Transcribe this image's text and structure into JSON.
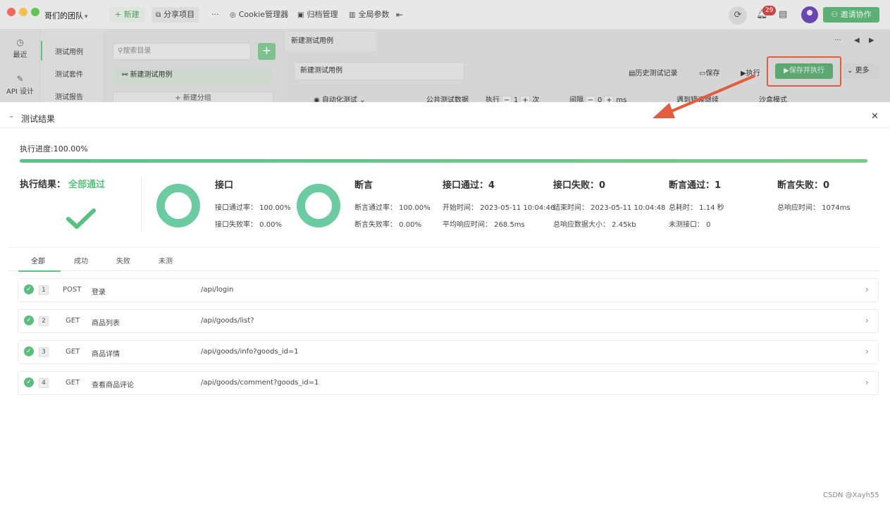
{
  "titlebar": {
    "team_name": "哥们的团队",
    "new_label": "+ 新建",
    "share_label": "分享项目",
    "dots_label": "···",
    "cookie_label": "Cookie管理器",
    "archive_label": "归档管理",
    "params_label": "全局参数",
    "notification_count": "29",
    "invite_label": "邀请协作"
  },
  "leftnav": {
    "items": [
      {
        "label": "最近",
        "icon": "clock-icon"
      },
      {
        "label": "API 设计",
        "icon": "edit-icon"
      }
    ]
  },
  "subnav": {
    "items": [
      "测试用例",
      "测试套件",
      "测试报告"
    ]
  },
  "tree": {
    "search_placeholder": "搜索目录",
    "node_label": "新建测试用例",
    "new_group_label": "+ 新建分组"
  },
  "editor": {
    "tab_label": "新建测试用例",
    "case_name": "新建测试用例",
    "history_label": "历史测试记录",
    "save_label": "保存",
    "run_label": "执行",
    "save_run_label": "保存并执行",
    "more_label": "更多",
    "options": {
      "mode_label": "自动化测试",
      "public_data_label": "公共测试数据",
      "execute_label": "执行",
      "execute_count": "1",
      "times_label": "次",
      "interval_label": "间隔",
      "interval_value": "0",
      "ms_label": "ms",
      "continue_label": "遇到错误继续",
      "sandbox_label": "沙盒模式"
    }
  },
  "result": {
    "title": "测试结果",
    "progress_label": "执行进度:100.00%",
    "progress": 1.0,
    "result_label": "执行结果：",
    "result_value": "全部通过",
    "api_title": "接口",
    "api_pass_rate": "接口通过率：  100.00%",
    "api_fail_rate": "接口失败率：  0.00%",
    "assert_title": "断言",
    "assert_pass_rate": "断言通过率：  100.00%",
    "assert_fail_rate": "断言失败率：  0.00%",
    "api_passed": "接口通过：4",
    "start_time": "开始时间：  2023-05-11 10:04:46",
    "avg_response": "平均响应时间：  268.5ms",
    "api_failed": "接口失败：0",
    "end_time": "结束时间：  2023-05-11 10:04:48",
    "total_size": "总响应数据大小：  2.45kb",
    "assert_passed": "断言通过：1",
    "total_time": "总耗时：  1.14 秒",
    "untested": "未测接口：  0",
    "assert_failed": "断言失败：0",
    "total_response": "总响应时间：  1074ms",
    "tabs": [
      "全部",
      "成功",
      "失败",
      "未测"
    ],
    "rows": [
      {
        "index": "1",
        "method": "POST",
        "name": "登录",
        "path": "/api/login"
      },
      {
        "index": "2",
        "method": "GET",
        "name": "商品列表",
        "path": "/api/goods/list?"
      },
      {
        "index": "3",
        "method": "GET",
        "name": "商品详情",
        "path": "/api/goods/info?goods_id=1"
      },
      {
        "index": "4",
        "method": "GET",
        "name": "查看商品评论",
        "path": "/api/goods/comment?goods_id=1"
      }
    ]
  },
  "watermark": "CSDN @Xayh55",
  "colors": {
    "accent_green": "#57c17e",
    "ring_green": "#6ccba2",
    "annotation_red": "#e25d3f"
  }
}
